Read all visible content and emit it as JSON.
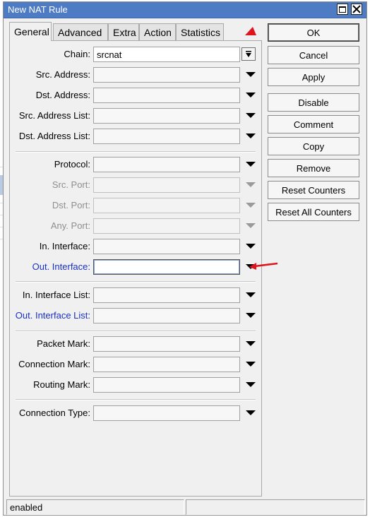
{
  "window": {
    "title": "New NAT Rule"
  },
  "tabs": [
    "General",
    "Advanced",
    "Extra",
    "Action",
    "Statistics"
  ],
  "fields": {
    "chain": {
      "label": "Chain:",
      "value": "srcnat"
    },
    "src_address": {
      "label": "Src. Address:",
      "value": ""
    },
    "dst_address": {
      "label": "Dst. Address:",
      "value": ""
    },
    "src_address_list": {
      "label": "Src. Address List:",
      "value": ""
    },
    "dst_address_list": {
      "label": "Dst. Address List:",
      "value": ""
    },
    "protocol": {
      "label": "Protocol:",
      "value": ""
    },
    "src_port": {
      "label": "Src. Port:",
      "value": ""
    },
    "dst_port": {
      "label": "Dst. Port:",
      "value": ""
    },
    "any_port": {
      "label": "Any. Port:",
      "value": ""
    },
    "in_interface": {
      "label": "In. Interface:",
      "value": ""
    },
    "out_interface": {
      "label": "Out. Interface:",
      "value": ""
    },
    "in_interface_list": {
      "label": "In. Interface List:",
      "value": ""
    },
    "out_interface_list": {
      "label": "Out. Interface List:",
      "value": ""
    },
    "packet_mark": {
      "label": "Packet Mark:",
      "value": ""
    },
    "connection_mark": {
      "label": "Connection Mark:",
      "value": ""
    },
    "routing_mark": {
      "label": "Routing Mark:",
      "value": ""
    },
    "connection_type": {
      "label": "Connection Type:",
      "value": ""
    }
  },
  "buttons": {
    "ok": "OK",
    "cancel": "Cancel",
    "apply": "Apply",
    "disable": "Disable",
    "comment": "Comment",
    "copy": "Copy",
    "remove": "Remove",
    "reset_counters": "Reset Counters",
    "reset_all_counters": "Reset All Counters"
  },
  "status": {
    "left": "enabled",
    "right": ""
  },
  "colors": {
    "titlebar": "#4d7bc4",
    "highlight_label": "#1a30c4",
    "annotation": "#e0141e"
  }
}
